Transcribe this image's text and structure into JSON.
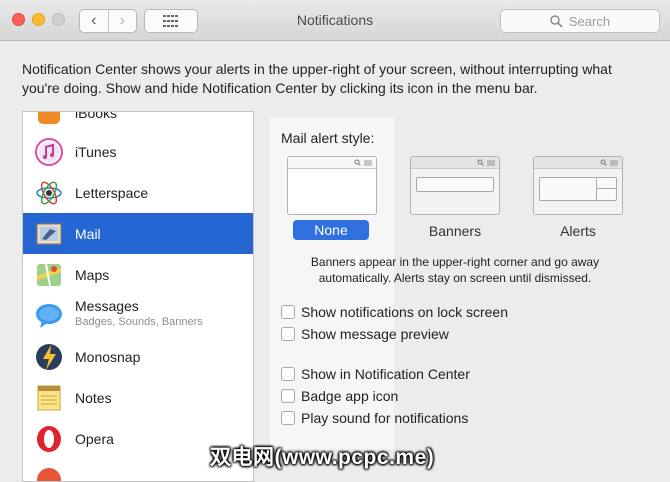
{
  "window": {
    "title": "Notifications",
    "back_glyph": "‹",
    "forward_glyph": "›",
    "search_placeholder": "Search"
  },
  "description": "Notification Center shows your alerts in the upper-right of your screen, without interrupting what you're doing. Show and hide Notification Center by clicking its icon in the menu bar.",
  "sidebar": {
    "items": [
      {
        "name": "iBooks",
        "icon": "ibooks-icon"
      },
      {
        "name": "iTunes",
        "icon": "itunes-icon"
      },
      {
        "name": "Letterspace",
        "icon": "letterspace-icon"
      },
      {
        "name": "Mail",
        "icon": "mail-icon",
        "selected": true
      },
      {
        "name": "Maps",
        "icon": "maps-icon"
      },
      {
        "name": "Messages",
        "subtitle": "Badges, Sounds, Banners",
        "icon": "messages-icon"
      },
      {
        "name": "Monosnap",
        "icon": "monosnap-icon"
      },
      {
        "name": "Notes",
        "icon": "notes-icon"
      },
      {
        "name": "Opera",
        "icon": "opera-icon"
      }
    ]
  },
  "settings": {
    "alert_style_title": "Mail alert style:",
    "styles": [
      "None",
      "Banners",
      "Alerts"
    ],
    "selected_style": "None",
    "info_text_1": "Banners appear in the upper-right corner and go away",
    "info_text_2": "automatically. Alerts stay on screen until dismissed.",
    "checkboxes": [
      {
        "label": "Show notifications on lock screen",
        "checked": false
      },
      {
        "label": "Show message preview",
        "checked": false
      },
      {
        "label": "Show in Notification Center",
        "checked": false
      },
      {
        "label": "Badge app icon",
        "checked": false
      },
      {
        "label": "Play sound for notifications",
        "checked": false
      }
    ]
  },
  "watermark": "双电网(www.pcpc.me)",
  "colors": {
    "selection_blue": "#2566d3",
    "close": "#fc5f57",
    "minimize": "#fdbc2e"
  }
}
